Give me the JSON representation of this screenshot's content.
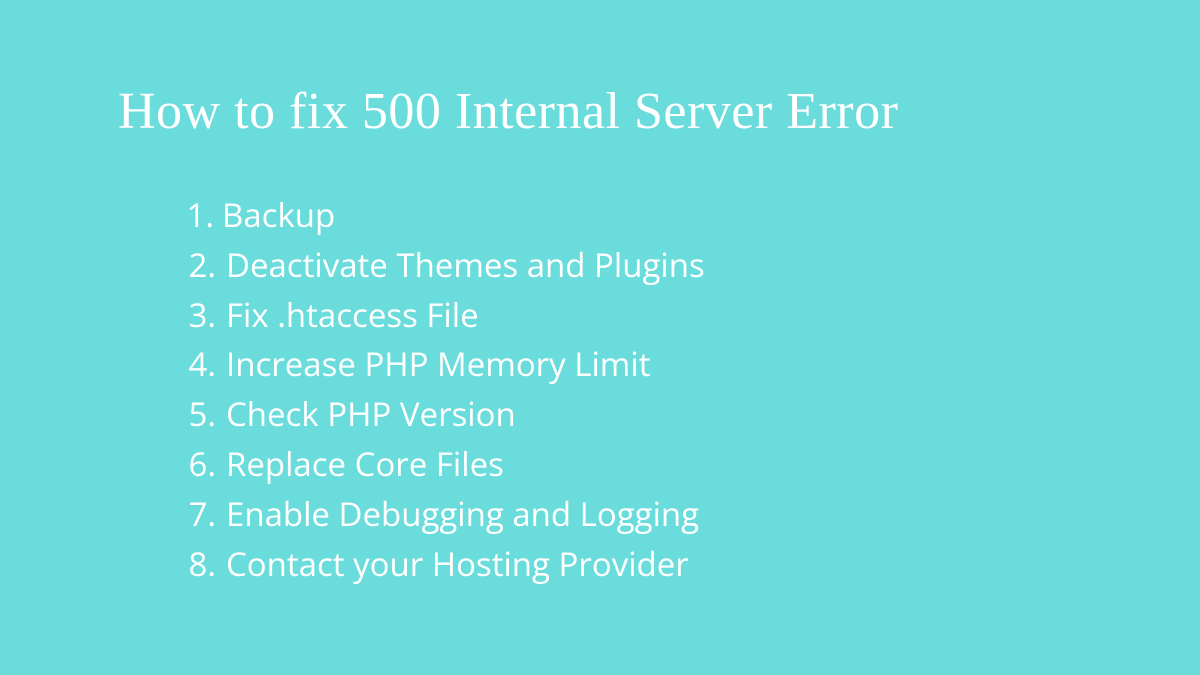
{
  "title": "How to fix 500 Internal Server Error",
  "steps": [
    "Backup",
    "Deactivate Themes and Plugins",
    "Fix .htaccess File",
    "Increase PHP Memory Limit",
    "Check PHP Version",
    "Replace Core Files",
    "Enable Debugging and Logging",
    "Contact your Hosting Provider"
  ],
  "colors": {
    "background": "#6bdcdc",
    "text": "#ffffff"
  }
}
